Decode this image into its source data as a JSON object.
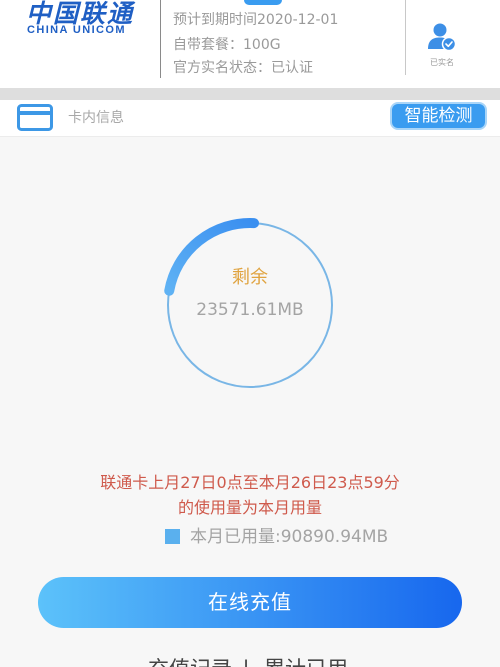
{
  "header": {
    "logo": {
      "cn": "中国联通",
      "en": "CHINA UNICOM"
    },
    "expiry": "预计到期时间2020-12-01",
    "package": "自带套餐：100G",
    "realname_status": "官方实名状态：已认证",
    "verified_label": "已实名"
  },
  "card_info": {
    "title": "卡内信息",
    "detect_button": "智能检测"
  },
  "gauge": {
    "label": "剩余",
    "remaining": "23571.61MB",
    "remaining_fraction": 0.23
  },
  "usage": {
    "note_line1": "联通卡上月27日0点至本月26日23点59分",
    "note_line2": "的使用量为本月用量",
    "legend": "本月已用量:90890.94MB"
  },
  "recharge_button": "在线充值",
  "bottom_links": {
    "records": "充值记录",
    "separator": "|",
    "cumulative": "累计已用"
  },
  "colors": {
    "accent": "#3a9cf0",
    "brand": "#1f5fc4",
    "note_text": "#cf5a4c",
    "remaining_label": "#e0a33f",
    "legend_swatch": "#5ab0ee"
  },
  "icons": {
    "card": "card-icon",
    "verified_user": "verified-user-icon"
  }
}
